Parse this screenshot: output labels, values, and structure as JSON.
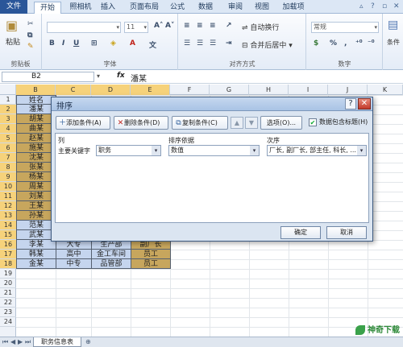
{
  "ribbon": {
    "file_tab": "文件",
    "tabs": [
      "开始",
      "插入",
      "页面布局",
      "公式",
      "数据",
      "审阅",
      "视图",
      "加载项"
    ],
    "tab_extra": "照相机",
    "groups": {
      "clipboard": "剪贴板",
      "font": "字体",
      "alignment": "对齐方式",
      "number": "数字"
    },
    "paste_label": "粘贴",
    "font_size": "11",
    "wrap_text": "自动换行",
    "merge_center": "合并后居中",
    "number_format": "常规",
    "percent": "%",
    "comma": ",",
    "styles_label": "条件"
  },
  "formula_bar": {
    "name_box": "B2",
    "fx": "fx",
    "content": "潘某"
  },
  "columns": [
    "B",
    "C",
    "D",
    "E",
    "F",
    "G",
    "H",
    "I",
    "J",
    "K"
  ],
  "rows": [
    "1",
    "2",
    "3",
    "4",
    "5",
    "6",
    "7",
    "8",
    "9",
    "10",
    "11",
    "12",
    "13",
    "14",
    "15",
    "16",
    "17",
    "18",
    "19",
    "20",
    "21",
    "22",
    "23",
    "24"
  ],
  "cells": {
    "b": [
      "姓名",
      "潘某",
      "胡某",
      "曲某",
      "赵某",
      "施某",
      "沈某",
      "张某",
      "杨某",
      "周某",
      "刘某",
      "王某",
      "孙某",
      "范某",
      "武某",
      "李某",
      "韩某",
      "金某"
    ],
    "row16": [
      "大专",
      "生产部",
      "副厂长"
    ],
    "row17": [
      "高中",
      "金工车间",
      "员工"
    ],
    "row18": [
      "中专",
      "品管部",
      "员工"
    ]
  },
  "sheet": {
    "tab_name": "职务信息表",
    "logo_text": "神奇下载"
  },
  "dialog": {
    "title": "排序",
    "help": "?",
    "close": "✕",
    "add_level": "添加条件(A)",
    "delete_level": "删除条件(D)",
    "copy_level": "复制条件(C)",
    "up_arrow": "▲",
    "down_arrow": "▼",
    "options": "选项(O)...",
    "has_headers": "数据包含标题(H)",
    "has_headers_checked": "✔",
    "col_header": "列",
    "sort_on_header": "排序依据",
    "order_header": "次序",
    "row_label": "主要关键字",
    "column_value": "职务",
    "sort_on_value": "数值",
    "order_value": "厂长, 副厂长, 部主任, 科长, ...",
    "ok": "确定",
    "cancel": "取消"
  }
}
